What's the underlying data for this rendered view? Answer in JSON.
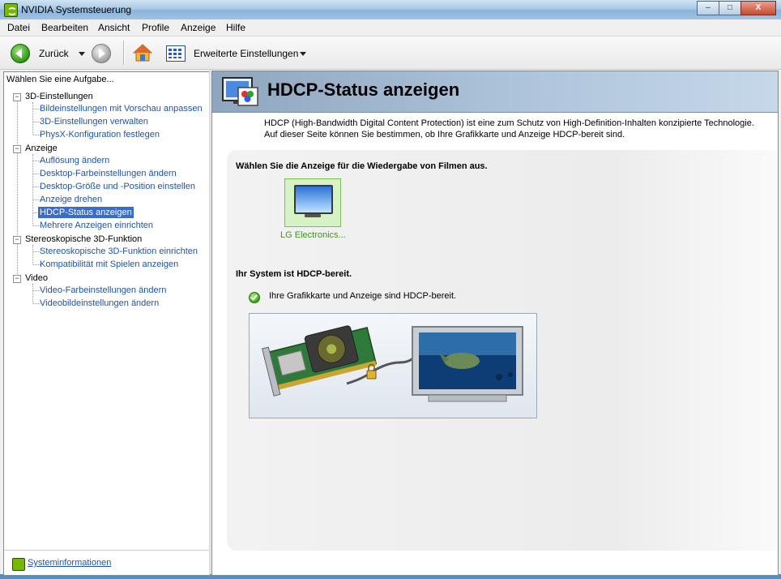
{
  "window": {
    "title": "NVIDIA Systemsteuerung",
    "buttons": {
      "minimize": "–",
      "maximize": "□",
      "close": "X"
    }
  },
  "menu": [
    "Datei",
    "Bearbeiten",
    "Ansicht",
    "Profile",
    "Anzeige",
    "Hilfe"
  ],
  "toolbar": {
    "back_label": "Zurück",
    "advanced_label": "Erweiterte Einstellungen"
  },
  "sidebar": {
    "header": "Wählen Sie eine Aufgabe...",
    "categories": [
      {
        "label": "3D-Einstellungen",
        "items": [
          "Bildeinstellungen mit Vorschau anpassen",
          "3D-Einstellungen verwalten",
          "PhysX-Konfiguration festlegen"
        ]
      },
      {
        "label": "Anzeige",
        "items": [
          "Auflösung ändern",
          "Desktop-Farbeinstellungen ändern",
          "Desktop-Größe und -Position einstellen",
          "Anzeige drehen",
          "HDCP-Status anzeigen",
          "Mehrere Anzeigen einrichten"
        ]
      },
      {
        "label": "Stereoskopische 3D-Funktion",
        "items": [
          "Stereoskopische 3D-Funktion einrichten",
          "Kompatibilität mit Spielen anzeigen"
        ]
      },
      {
        "label": "Video",
        "items": [
          "Video-Farbeinstellungen ändern",
          "Videobildeinstellungen ändern"
        ]
      }
    ],
    "selected": "HDCP-Status anzeigen",
    "footer_link": "Systeminformationen"
  },
  "content": {
    "title": "HDCP-Status anzeigen",
    "intro": "HDCP (High-Bandwidth Digital Content Protection) ist eine zum Schutz von High-Definition-Inhalten konzipierte Technologie. Auf dieser Seite können Sie bestimmen, ob Ihre Grafikkarte und Anzeige HDCP-bereit sind.",
    "choose_display": "Wählen Sie die Anzeige für die Wiedergabe von Filmen aus.",
    "display_name": "LG Electronics...",
    "status_heading": "Ihr System ist HDCP-bereit.",
    "status_detail": "Ihre Grafikkarte und Anzeige sind HDCP-bereit."
  },
  "colors": {
    "link": "#1f53a8",
    "selection": "#3a6ccb",
    "nvidia_green": "#76b900"
  }
}
